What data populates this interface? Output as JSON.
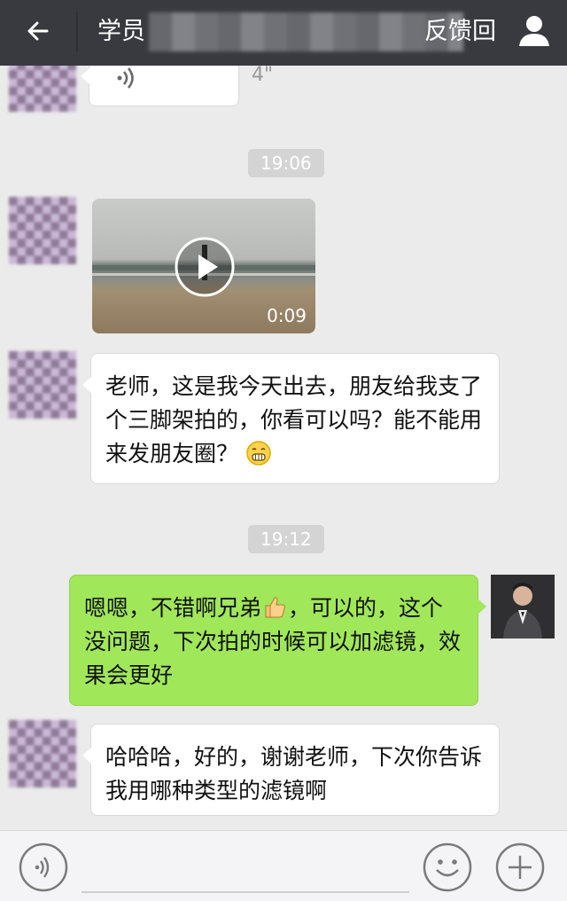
{
  "header": {
    "title_prefix": "学员",
    "title_suffix": "反馈回"
  },
  "messages": {
    "voice": {
      "duration": "4\""
    },
    "time1": "19:06",
    "video": {
      "duration": "0:09"
    },
    "msg1": "老师，这是我今天出去，朋友给我支了个三脚架拍的，你看可以吗？能不能用来发朋友圈？",
    "time2": "19:12",
    "reply_part1": "嗯嗯，不错啊兄弟",
    "reply_part2": "，可以的，这个没问题，下次拍的时候可以加滤镜，效果会更好",
    "msg2": "哈哈哈，好的，谢谢老师，下次你告诉我用哪种类型的滤镜啊"
  },
  "icons": {
    "back": "back-arrow-icon",
    "profile": "person-icon",
    "voice": "voice-wave-icon",
    "play": "play-icon",
    "grin": "grin-emoji-icon",
    "thumbs": "thumbs-up-emoji-icon",
    "emoji": "smiley-icon",
    "plus": "plus-icon"
  },
  "colors": {
    "header_bg": "#393a3f",
    "chat_bg": "#ebebeb",
    "bubble_self": "#a0e75a",
    "bubble_other": "#ffffff"
  }
}
